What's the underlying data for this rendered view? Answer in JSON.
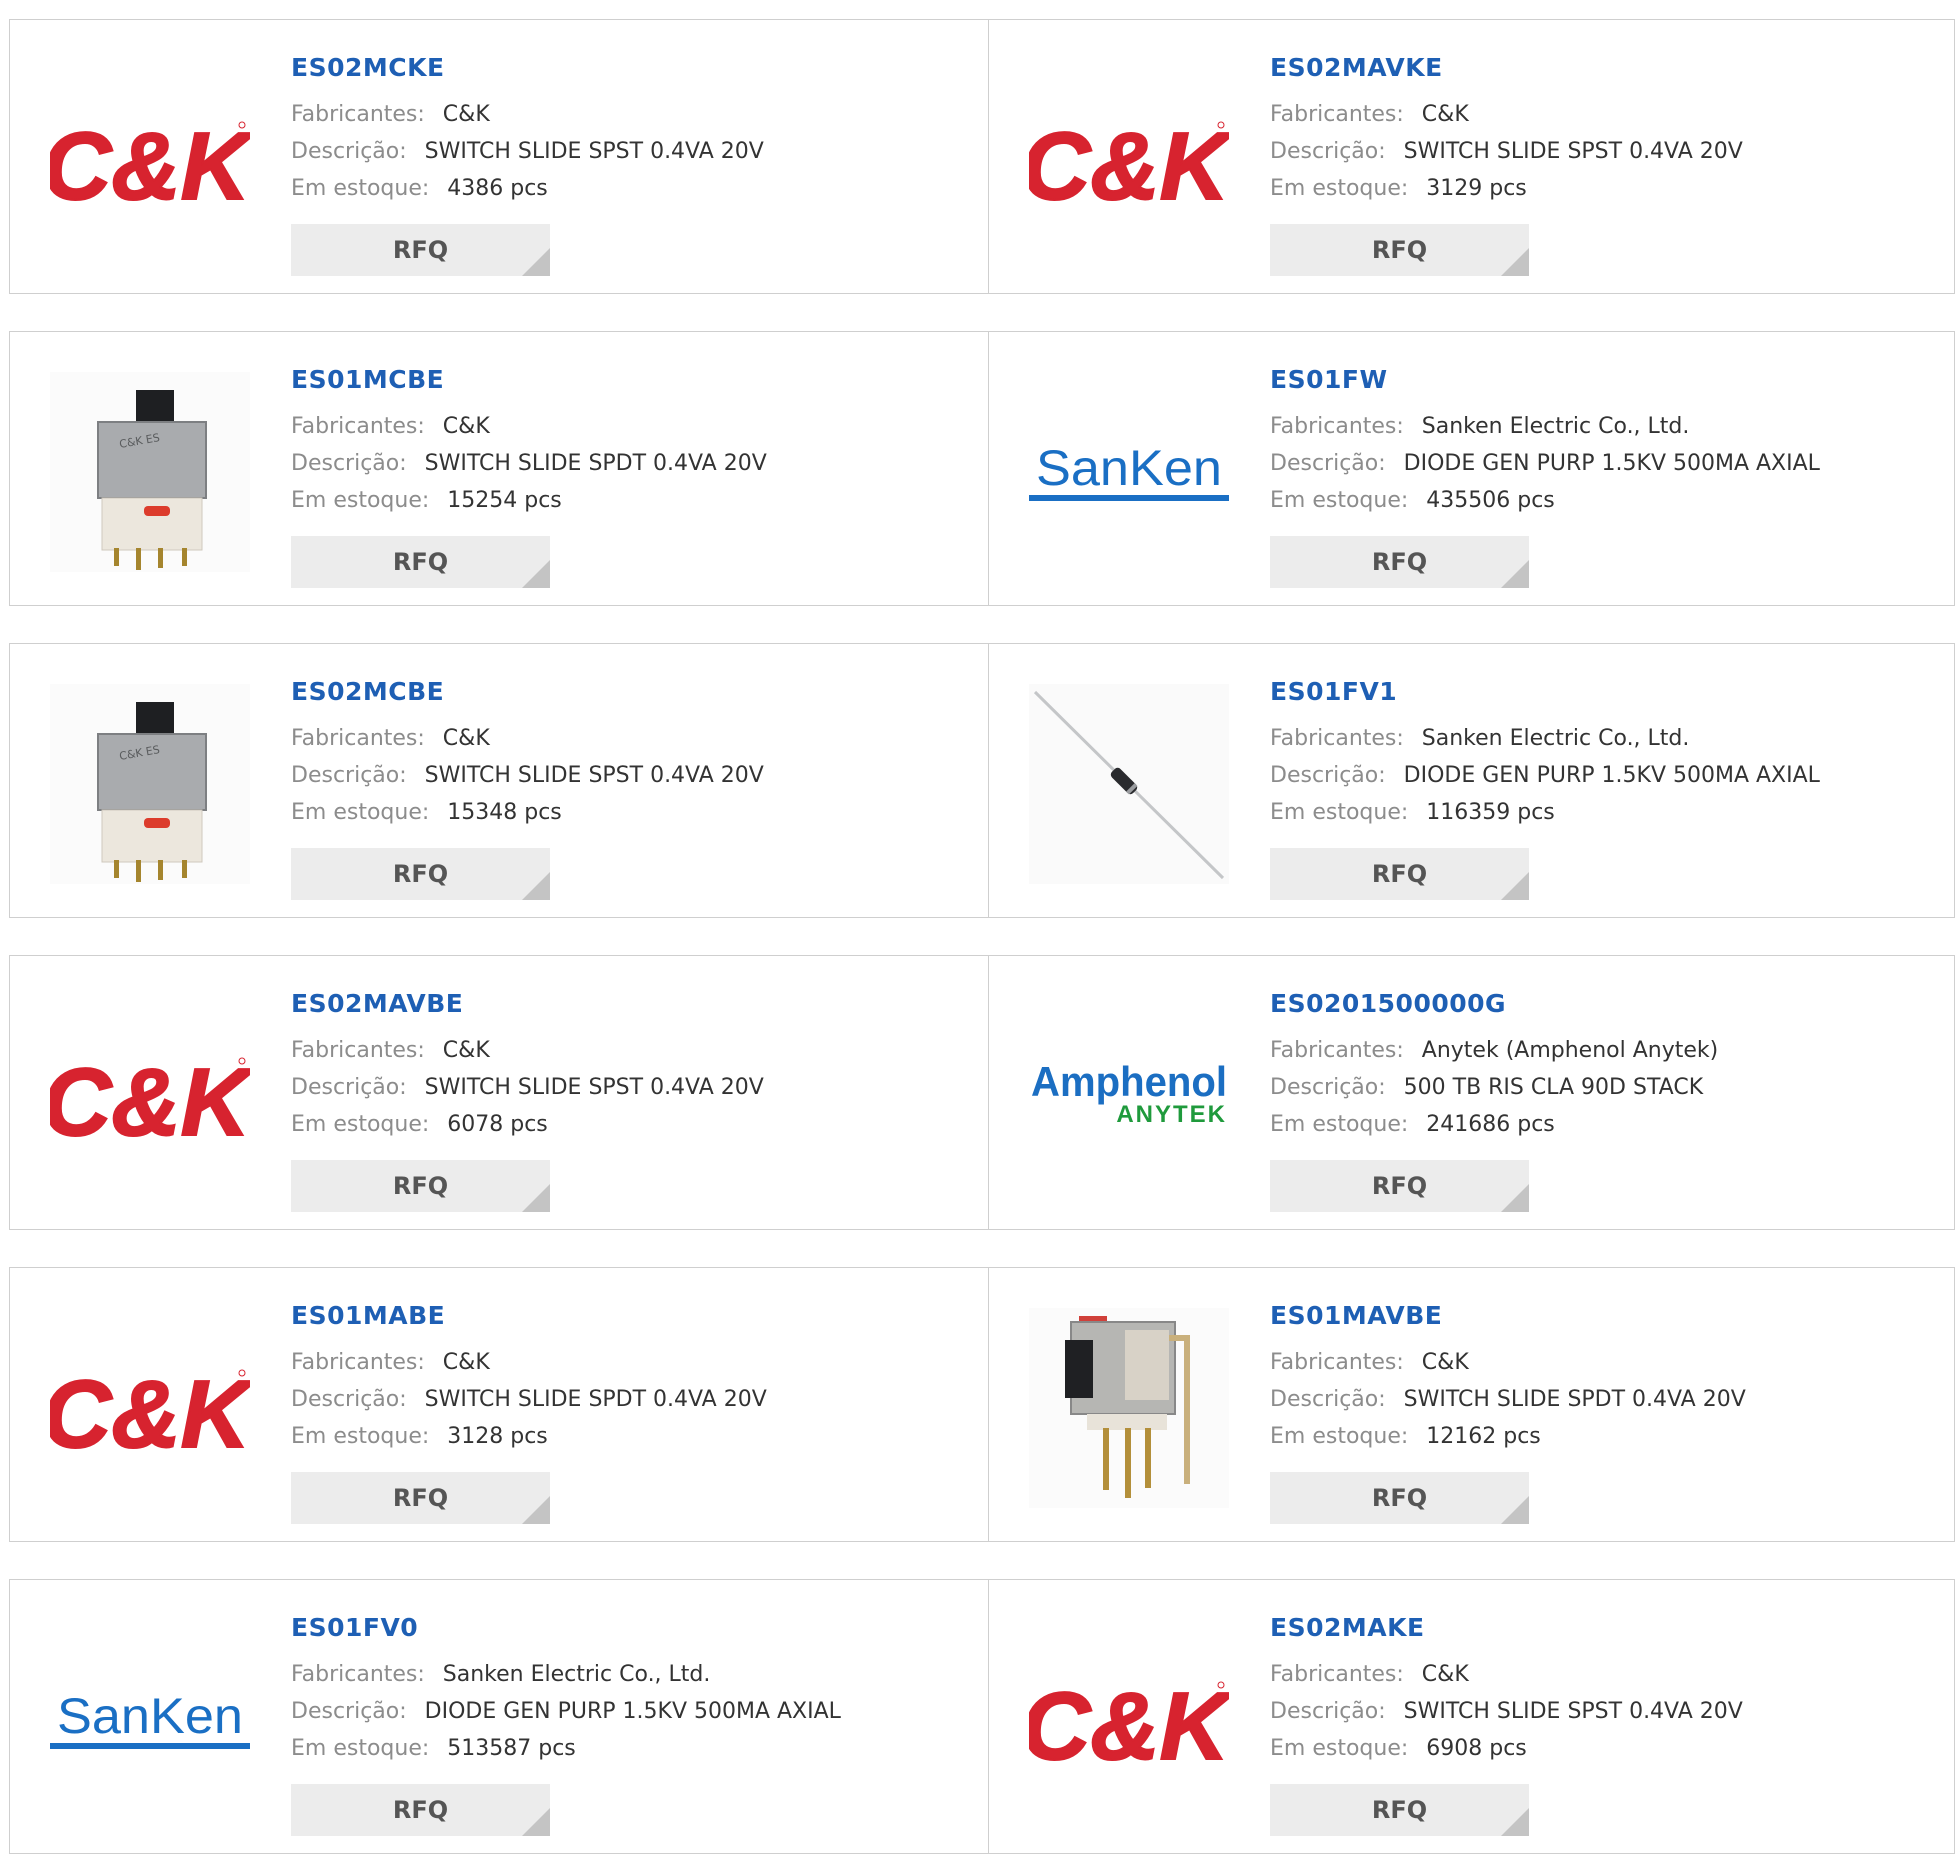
{
  "labels": {
    "manufacturer": "Fabricantes:",
    "description": "Descrição:",
    "stock": "Em estoque:",
    "rfq": "RFQ"
  },
  "logo_text": {
    "ck": "C&K",
    "sanken": "SanKen",
    "amphenol_main": "Amphenol",
    "amphenol_sub": "ANYTEK"
  },
  "colors": {
    "part_number": "#1e5fb4",
    "label": "#8c8c8c",
    "value": "#333333",
    "ck_red": "#d7232f",
    "sanken_blue": "#1a6fc4",
    "amphenol_blue": "#1b6ec2",
    "amphenol_green": "#1f9a3c",
    "border": "#cfcfcf",
    "button": "#ececec"
  },
  "products": [
    {
      "part": "ES02MCKE",
      "manufacturer": "C&K",
      "description": "SWITCH SLIDE SPST 0.4VA 20V",
      "stock": "4386 pcs",
      "image": "ck-logo"
    },
    {
      "part": "ES02MAVKE",
      "manufacturer": "C&K",
      "description": "SWITCH SLIDE SPST 0.4VA 20V",
      "stock": "3129 pcs",
      "image": "ck-logo"
    },
    {
      "part": "ES01MCBE",
      "manufacturer": "C&K",
      "description": "SWITCH SLIDE SPDT 0.4VA 20V",
      "stock": "15254 pcs",
      "image": "slide-switch-photo"
    },
    {
      "part": "ES01FW",
      "manufacturer": "Sanken Electric Co., Ltd.",
      "description": "DIODE GEN PURP 1.5KV 500MA AXIAL",
      "stock": "435506 pcs",
      "image": "sanken-logo"
    },
    {
      "part": "ES02MCBE",
      "manufacturer": "C&K",
      "description": "SWITCH SLIDE SPST 0.4VA 20V",
      "stock": "15348 pcs",
      "image": "slide-switch-photo"
    },
    {
      "part": "ES01FV1",
      "manufacturer": "Sanken Electric Co., Ltd.",
      "description": "DIODE GEN PURP 1.5KV 500MA AXIAL",
      "stock": "116359 pcs",
      "image": "axial-diode-photo"
    },
    {
      "part": "ES02MAVBE",
      "manufacturer": "C&K",
      "description": "SWITCH SLIDE SPST 0.4VA 20V",
      "stock": "6078 pcs",
      "image": "ck-logo"
    },
    {
      "part": "ES0201500000G",
      "manufacturer": "Anytek (Amphenol Anytek)",
      "description": "500 TB RIS CLA 90D STACK",
      "stock": "241686 pcs",
      "image": "amphenol-anytek-logo"
    },
    {
      "part": "ES01MABE",
      "manufacturer": "C&K",
      "description": "SWITCH SLIDE SPDT 0.4VA 20V",
      "stock": "3128 pcs",
      "image": "ck-logo"
    },
    {
      "part": "ES01MAVBE",
      "manufacturer": "C&K",
      "description": "SWITCH SLIDE SPDT 0.4VA 20V",
      "stock": "12162 pcs",
      "image": "right-angle-switch-photo"
    },
    {
      "part": "ES01FV0",
      "manufacturer": "Sanken Electric Co., Ltd.",
      "description": "DIODE GEN PURP 1.5KV 500MA AXIAL",
      "stock": "513587 pcs",
      "image": "sanken-logo"
    },
    {
      "part": "ES02MAKE",
      "manufacturer": "C&K",
      "description": "SWITCH SLIDE SPST 0.4VA 20V",
      "stock": "6908 pcs",
      "image": "ck-logo"
    }
  ]
}
